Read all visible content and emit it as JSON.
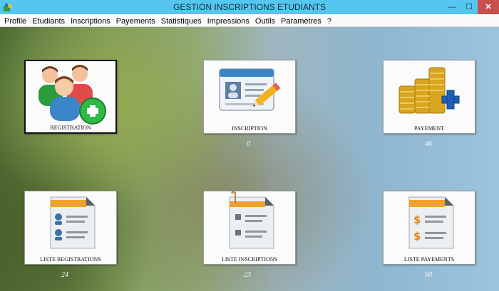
{
  "window": {
    "title": "GESTION INSCRIPTIONS ETUDIANTS",
    "buttons": {
      "minimize": "—",
      "maximize": "☐",
      "close": "✕"
    }
  },
  "menu": [
    "Profile",
    "Etudiants",
    "Inscriptions",
    "Payements",
    "Statistiques",
    "Impressions",
    "Outils",
    "Paramètres",
    "?"
  ],
  "tiles": {
    "registration": {
      "label": "REGISTRATION"
    },
    "inscription": {
      "label": "INSCRIPTION",
      "count": "0"
    },
    "payement": {
      "label": "PAYEMENT",
      "count": "46"
    },
    "liste_registrations": {
      "label": "LISTE REGISTRATIONS",
      "count": "24"
    },
    "liste_inscriptions": {
      "label": "LISTE INSCRIPTIONS",
      "count": "23"
    },
    "liste_payements": {
      "label": "LISTE PAYEMENTS",
      "count": "90"
    }
  },
  "colors": {
    "titlebar": "#55c6ef",
    "close": "#c7504b",
    "accent_orange": "#f0a12e",
    "accent_green": "#2fb845",
    "accent_blue": "#1e5fb8"
  }
}
